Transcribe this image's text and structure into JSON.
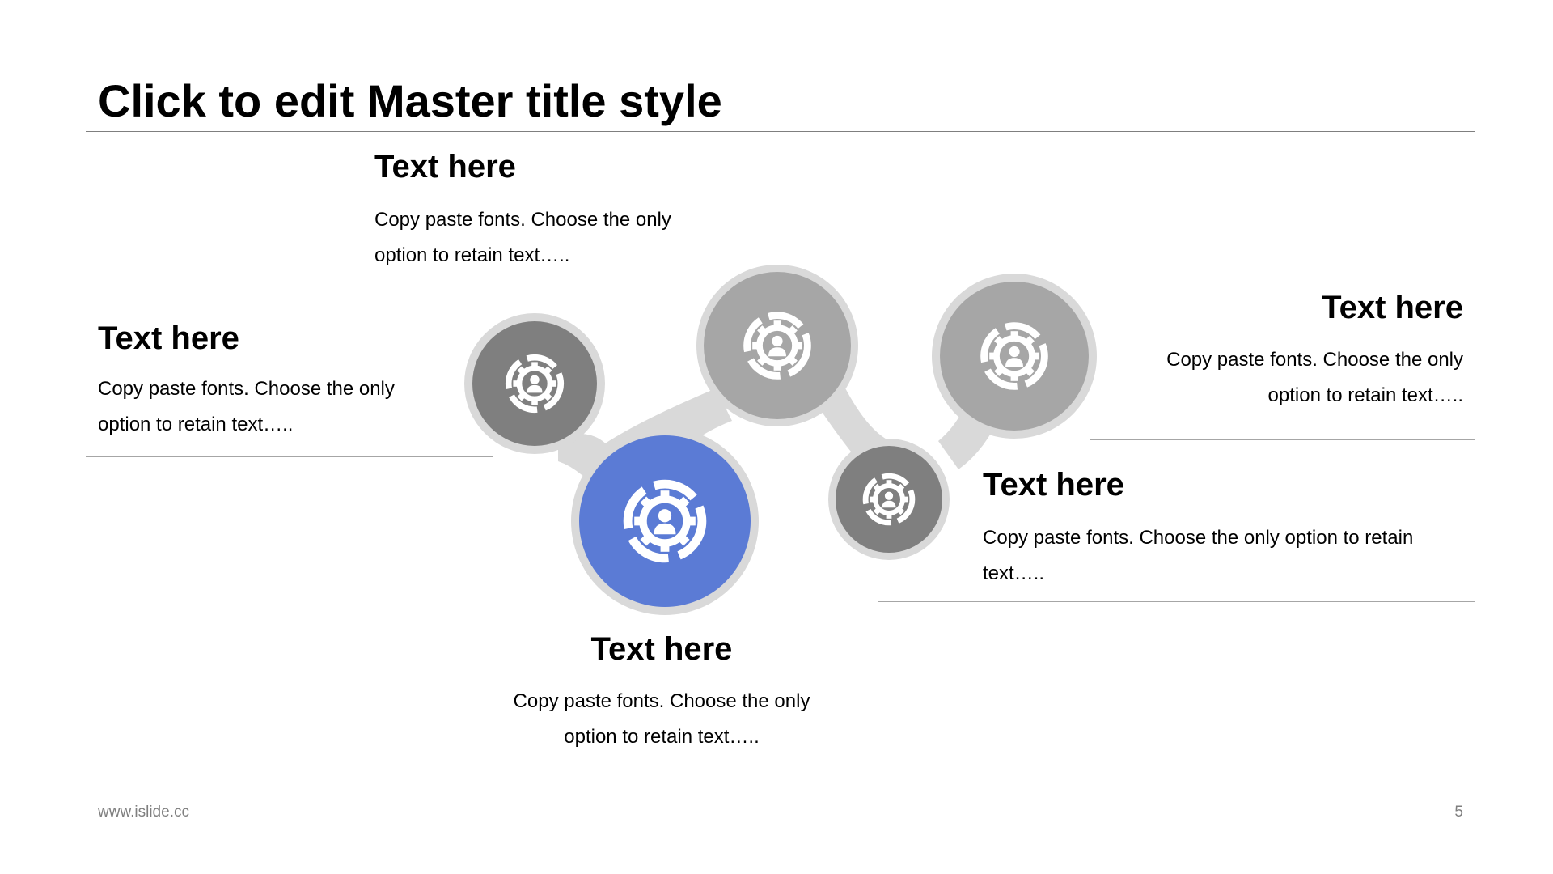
{
  "slide": {
    "title": "Click to edit Master title style"
  },
  "blocks": [
    {
      "title": "Text here",
      "body": "Copy paste fonts. Choose the only option to retain text….."
    },
    {
      "title": "Text here",
      "body": "Copy paste fonts. Choose the only option to retain text….."
    },
    {
      "title": "Text here",
      "body": "Copy paste fonts. Choose the only option to retain text….."
    },
    {
      "title": "Text here",
      "body": "Copy paste fonts. Choose the only option to retain text….."
    },
    {
      "title": "Text here",
      "body": "Copy paste fonts. Choose the only option to retain text….."
    }
  ],
  "diagram": {
    "nodes": [
      {
        "icon": "gear-user-icon",
        "color": "#7f7f7f"
      },
      {
        "icon": "gear-user-icon",
        "color": "#5b7bd5"
      },
      {
        "icon": "gear-user-icon",
        "color": "#a6a6a6"
      },
      {
        "icon": "gear-user-icon",
        "color": "#7f7f7f"
      },
      {
        "icon": "gear-user-icon",
        "color": "#a6a6a6"
      }
    ],
    "connector_color": "#d9d9d9"
  },
  "footer": {
    "website": "www.islide.cc",
    "page_number": "5"
  }
}
